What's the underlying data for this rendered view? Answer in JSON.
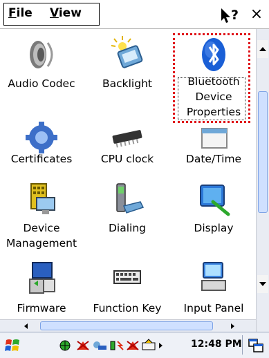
{
  "menu": {
    "file_label": "File",
    "view_label": "View",
    "help_label": "?",
    "close_label": "×"
  },
  "items": [
    {
      "label": "Audio Codec",
      "icon": "speaker-icon"
    },
    {
      "label": "Backlight",
      "icon": "backlight-icon"
    },
    {
      "label": "Bluetooth Device Properties",
      "lines": [
        "Bluetooth",
        "Device",
        "Properties"
      ],
      "icon": "bluetooth-icon",
      "selected": true
    },
    {
      "label": "Certificates",
      "icon": "certificate-icon"
    },
    {
      "label": "CPU clock",
      "icon": "cpu-chip-icon"
    },
    {
      "label": "Date/Time",
      "icon": "calendar-icon"
    },
    {
      "label": "Device Management",
      "lines": [
        "Device",
        "Management"
      ],
      "icon": "device-management-icon"
    },
    {
      "label": "Dialing",
      "icon": "dialing-icon"
    },
    {
      "label": "Display",
      "icon": "display-icon"
    },
    {
      "label": "Firmware",
      "icon": "firmware-icon"
    },
    {
      "label": "Function Key",
      "icon": "keyboard-icon"
    },
    {
      "label": "Input Panel",
      "icon": "input-panel-icon"
    }
  ],
  "taskbar": {
    "clock": "12:48 PM"
  },
  "colors": {
    "selection_border": "#e0141a",
    "scroll_thumb": "#cfe0ff",
    "bluetooth_blue": "#1a5fd6"
  }
}
